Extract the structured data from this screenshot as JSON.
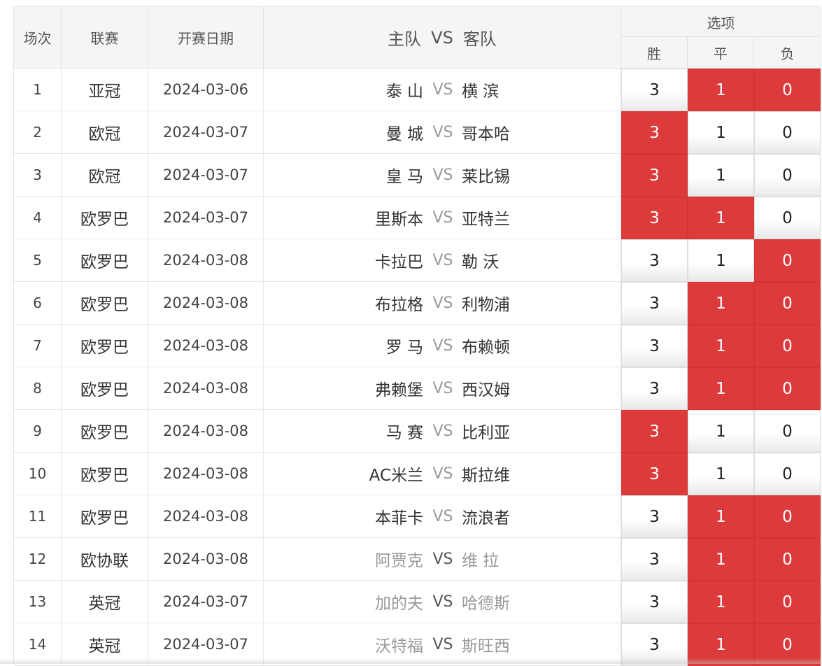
{
  "header": {
    "col_index": "场次",
    "col_league": "联赛",
    "col_date": "开赛日期",
    "col_home": "主队",
    "col_vs": "VS",
    "col_away": "客队",
    "options_title": "选项",
    "opt_win": "胜",
    "opt_draw": "平",
    "opt_loss": "负"
  },
  "colors": {
    "selected": "#dd3b3b",
    "dim_text": "#999999"
  },
  "rows": [
    {
      "idx": "1",
      "league": "亚冠",
      "date": "2024-03-06",
      "home": "泰 山",
      "vs": "VS",
      "away": "横 滨",
      "o1": "3",
      "o2": "1",
      "o3": "0",
      "sel": [
        false,
        true,
        true
      ],
      "dim": false
    },
    {
      "idx": "2",
      "league": "欧冠",
      "date": "2024-03-07",
      "home": "曼 城",
      "vs": "VS",
      "away": "哥本哈",
      "o1": "3",
      "o2": "1",
      "o3": "0",
      "sel": [
        true,
        false,
        false
      ],
      "dim": false
    },
    {
      "idx": "3",
      "league": "欧冠",
      "date": "2024-03-07",
      "home": "皇 马",
      "vs": "VS",
      "away": "莱比锡",
      "o1": "3",
      "o2": "1",
      "o3": "0",
      "sel": [
        true,
        false,
        false
      ],
      "dim": false
    },
    {
      "idx": "4",
      "league": "欧罗巴",
      "date": "2024-03-07",
      "home": "里斯本",
      "vs": "VS",
      "away": "亚特兰",
      "o1": "3",
      "o2": "1",
      "o3": "0",
      "sel": [
        true,
        true,
        false
      ],
      "dim": false
    },
    {
      "idx": "5",
      "league": "欧罗巴",
      "date": "2024-03-08",
      "home": "卡拉巴",
      "vs": "VS",
      "away": "勒 沃",
      "o1": "3",
      "o2": "1",
      "o3": "0",
      "sel": [
        false,
        false,
        true
      ],
      "dim": false
    },
    {
      "idx": "6",
      "league": "欧罗巴",
      "date": "2024-03-08",
      "home": "布拉格",
      "vs": "VS",
      "away": "利物浦",
      "o1": "3",
      "o2": "1",
      "o3": "0",
      "sel": [
        false,
        true,
        true
      ],
      "dim": false
    },
    {
      "idx": "7",
      "league": "欧罗巴",
      "date": "2024-03-08",
      "home": "罗 马",
      "vs": "VS",
      "away": "布赖顿",
      "o1": "3",
      "o2": "1",
      "o3": "0",
      "sel": [
        false,
        true,
        true
      ],
      "dim": false
    },
    {
      "idx": "8",
      "league": "欧罗巴",
      "date": "2024-03-08",
      "home": "弗赖堡",
      "vs": "VS",
      "away": "西汉姆",
      "o1": "3",
      "o2": "1",
      "o3": "0",
      "sel": [
        false,
        true,
        true
      ],
      "dim": false
    },
    {
      "idx": "9",
      "league": "欧罗巴",
      "date": "2024-03-08",
      "home": "马 赛",
      "vs": "VS",
      "away": "比利亚",
      "o1": "3",
      "o2": "1",
      "o3": "0",
      "sel": [
        true,
        false,
        false
      ],
      "dim": false
    },
    {
      "idx": "10",
      "league": "欧罗巴",
      "date": "2024-03-08",
      "home": "AC米兰",
      "vs": "VS",
      "away": "斯拉维",
      "o1": "3",
      "o2": "1",
      "o3": "0",
      "sel": [
        true,
        false,
        false
      ],
      "dim": false
    },
    {
      "idx": "11",
      "league": "欧罗巴",
      "date": "2024-03-08",
      "home": "本菲卡",
      "vs": "VS",
      "away": "流浪者",
      "o1": "3",
      "o2": "1",
      "o3": "0",
      "sel": [
        false,
        true,
        true
      ],
      "dim": false
    },
    {
      "idx": "12",
      "league": "欧协联",
      "date": "2024-03-08",
      "home": "阿贾克",
      "vs": "VS",
      "away": "维 拉",
      "o1": "3",
      "o2": "1",
      "o3": "0",
      "sel": [
        false,
        true,
        true
      ],
      "dim": true
    },
    {
      "idx": "13",
      "league": "英冠",
      "date": "2024-03-07",
      "home": "加的夫",
      "vs": "VS",
      "away": "哈德斯",
      "o1": "3",
      "o2": "1",
      "o3": "0",
      "sel": [
        false,
        true,
        true
      ],
      "dim": true
    },
    {
      "idx": "14",
      "league": "英冠",
      "date": "2024-03-07",
      "home": "沃特福",
      "vs": "VS",
      "away": "斯旺西",
      "o1": "3",
      "o2": "1",
      "o3": "0",
      "sel": [
        false,
        true,
        true
      ],
      "dim": true
    }
  ]
}
